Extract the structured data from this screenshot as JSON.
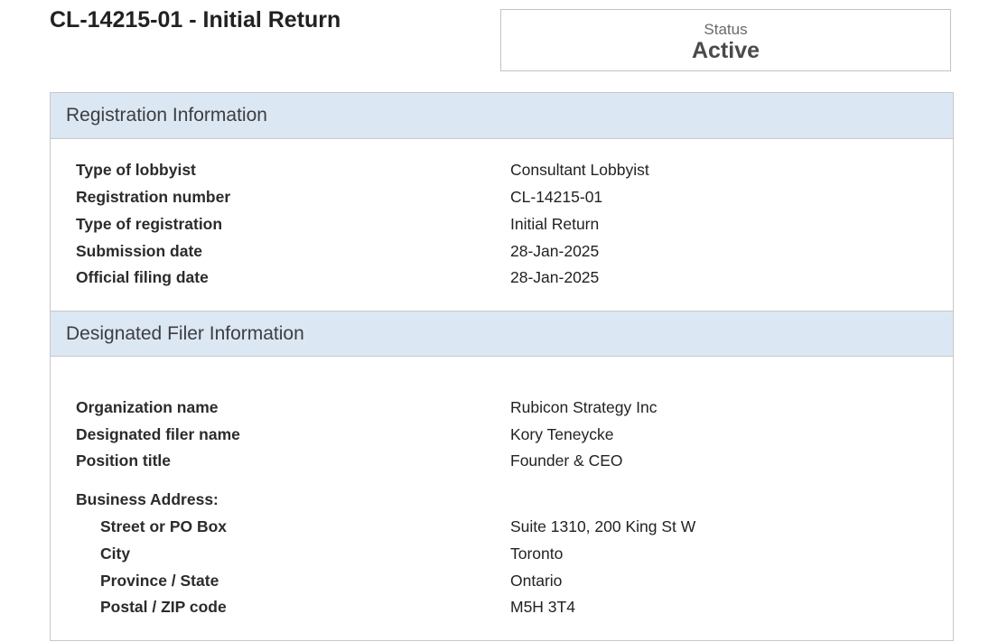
{
  "page": {
    "title": "CL-14215-01 - Initial Return"
  },
  "status": {
    "label": "Status",
    "value": "Active"
  },
  "registration": {
    "header": "Registration Information",
    "fields": [
      {
        "label": "Type of lobbyist",
        "value": "Consultant Lobbyist"
      },
      {
        "label": "Registration number",
        "value": "CL-14215-01"
      },
      {
        "label": "Type of registration",
        "value": "Initial Return"
      },
      {
        "label": "Submission date",
        "value": "28-Jan-2025"
      },
      {
        "label": "Official filing date",
        "value": "28-Jan-2025"
      }
    ]
  },
  "filer": {
    "header": "Designated Filer Information",
    "fields": [
      {
        "label": "Organization name",
        "value": "Rubicon Strategy Inc"
      },
      {
        "label": "Designated filer name",
        "value": "Kory Teneycke"
      },
      {
        "label": "Position title",
        "value": "Founder & CEO"
      }
    ],
    "address_heading": "Business Address:",
    "address": [
      {
        "label": "Street or PO Box",
        "value": "Suite 1310, 200 King St W"
      },
      {
        "label": "City",
        "value": "Toronto"
      },
      {
        "label": "Province / State",
        "value": "Ontario"
      },
      {
        "label": "Postal / ZIP code",
        "value": "M5H 3T4"
      }
    ]
  }
}
